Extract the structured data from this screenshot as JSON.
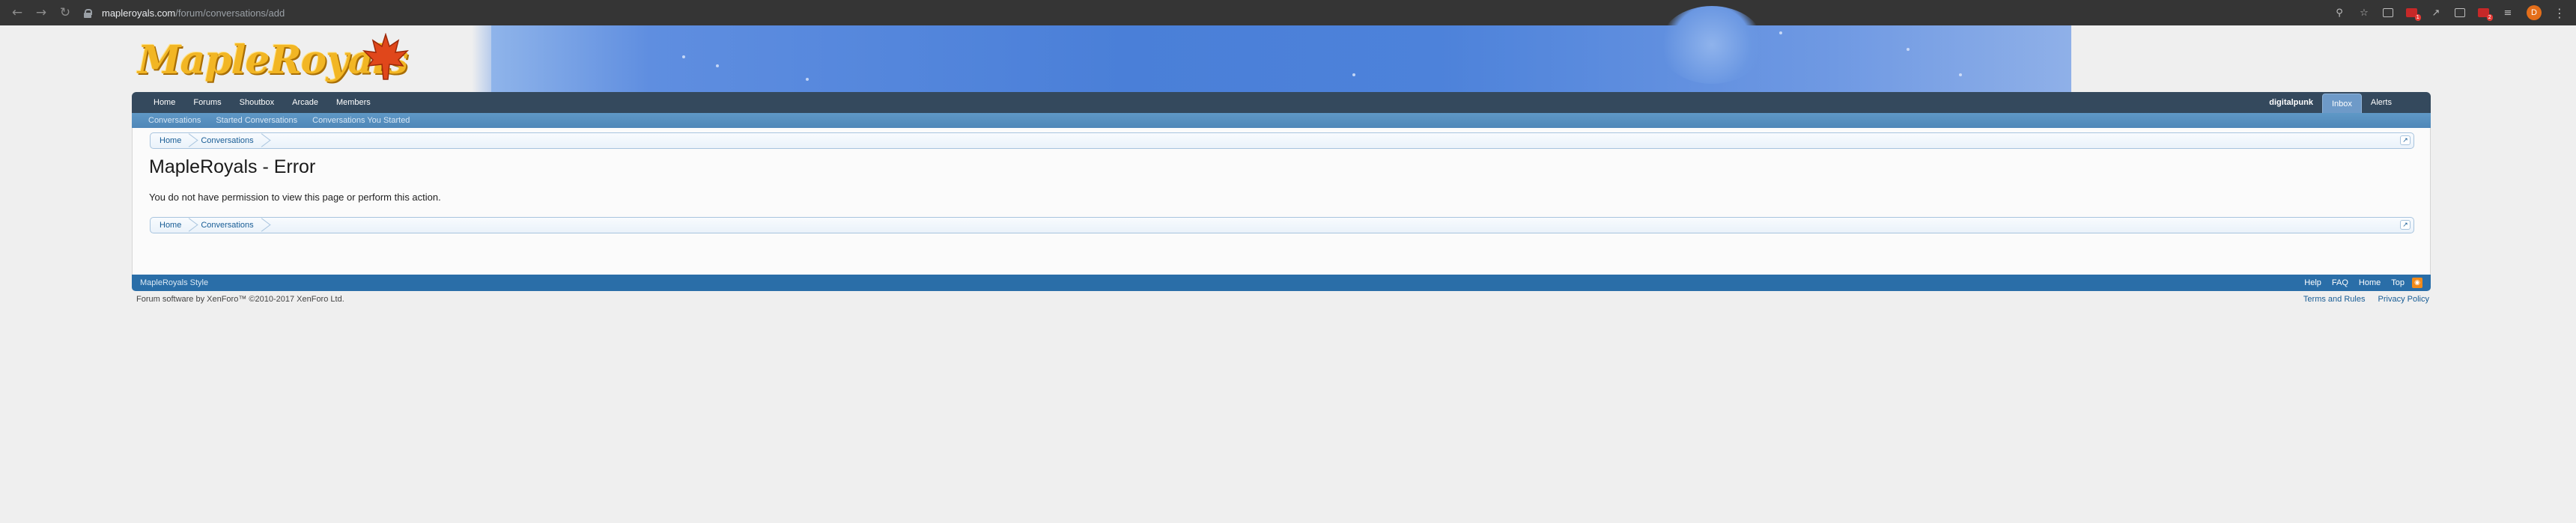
{
  "browser": {
    "url_host": "mapleroyals.com",
    "url_path": "/forum/conversations/add",
    "nav_icons": [
      "back-arrow-icon",
      "forward-arrow-icon",
      "reload-icon"
    ],
    "extension_icons": [
      "zoom-icon",
      "star-bookmark-icon",
      "cast-icon",
      "red-extension-icon",
      "open-external-icon",
      "puzzle-icon",
      "red-badge-extension-icon",
      "playlist-icon"
    ],
    "profile_initial": "D"
  },
  "site": {
    "logo_text": "MapleRoyals",
    "brand_color": "#f2b624"
  },
  "nav": {
    "left": [
      "Home",
      "Forums",
      "Shoutbox",
      "Arcade",
      "Members"
    ],
    "user": "digitalpunk",
    "inbox": "Inbox",
    "alerts": "Alerts"
  },
  "subnav": [
    "Conversations",
    "Started Conversations",
    "Conversations You Started"
  ],
  "breadcrumbs": [
    "Home",
    "Conversations"
  ],
  "error": {
    "title": "MapleRoyals - Error",
    "message": "You do not have permission to view this page or perform this action."
  },
  "footer": {
    "style": "MapleRoyals Style",
    "links": [
      "Help",
      "FAQ",
      "Home",
      "Top"
    ],
    "copyright": "Forum software by XenForo™ ©2010-2017 XenForo Ltd.",
    "legal": [
      "Terms and Rules",
      "Privacy Policy"
    ]
  }
}
